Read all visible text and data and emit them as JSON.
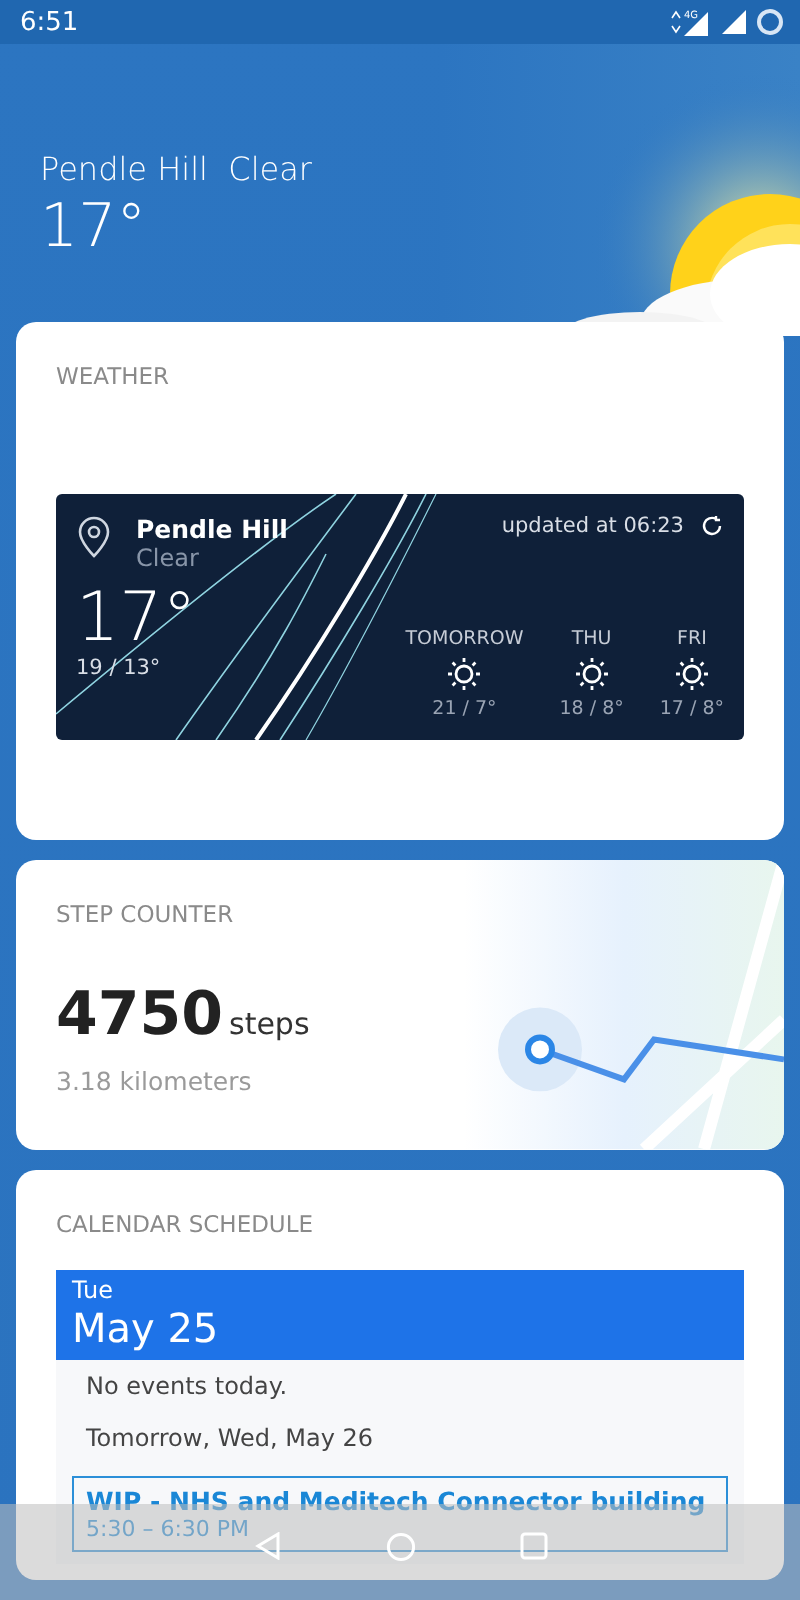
{
  "status_bar": {
    "time": "6:51",
    "network": "4G"
  },
  "header": {
    "location": "Pendle Hill",
    "condition": "Clear",
    "temperature": "17°"
  },
  "weather_card": {
    "title": "WEATHER",
    "widget": {
      "location": "Pendle Hill",
      "condition": "Clear",
      "updated": "updated at 06:23",
      "temperature": "17°",
      "range": "19 / 13°",
      "forecast": [
        {
          "day": "TOMORROW",
          "range": "21 / 7°"
        },
        {
          "day": "THU",
          "range": "18 / 8°"
        },
        {
          "day": "FRI",
          "range": "17 / 8°"
        }
      ]
    }
  },
  "step_card": {
    "title": "STEP COUNTER",
    "steps": "4750",
    "unit": "steps",
    "distance": "3.18 kilometers"
  },
  "calendar_card": {
    "title": "CALENDAR SCHEDULE",
    "weekday": "Tue",
    "date": "May 25",
    "today_note": "No events today.",
    "tomorrow": "Tomorrow, Wed, May 26",
    "events": [
      {
        "title": "WIP  - NHS and Meditech Connector building",
        "time": "5:30 – 6:30 PM"
      }
    ]
  }
}
